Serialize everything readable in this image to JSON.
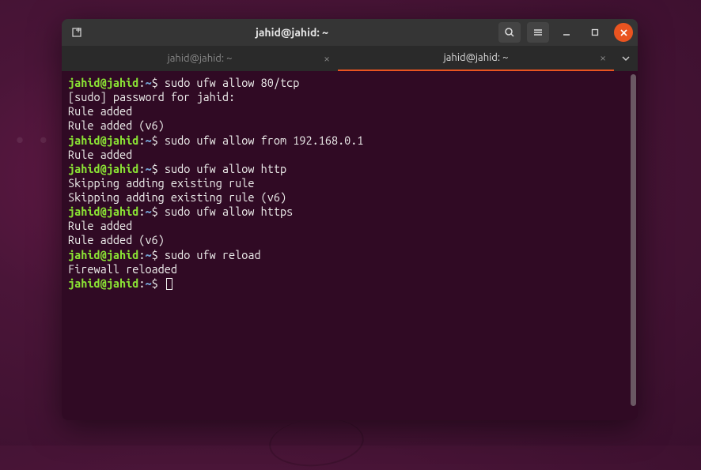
{
  "colors": {
    "accent": "#e95420",
    "terminal_bg": "#300a24",
    "prompt_user": "#8ae234",
    "prompt_path": "#729fcf",
    "text": "#eeeeec"
  },
  "titlebar": {
    "title": "jahid@jahid: ~"
  },
  "tabs": [
    {
      "label": "jahid@jahid: ~",
      "active": false
    },
    {
      "label": "jahid@jahid: ~",
      "active": true
    }
  ],
  "prompt": {
    "userhost": "jahid@jahid",
    "sep": ":",
    "path": "~",
    "symbol": "$"
  },
  "lines": [
    {
      "type": "cmd",
      "text": "sudo ufw allow 80/tcp"
    },
    {
      "type": "out",
      "text": "[sudo] password for jahid:"
    },
    {
      "type": "out",
      "text": "Rule added"
    },
    {
      "type": "out",
      "text": "Rule added (v6)"
    },
    {
      "type": "cmd",
      "text": "sudo ufw allow from 192.168.0.1"
    },
    {
      "type": "out",
      "text": "Rule added"
    },
    {
      "type": "cmd",
      "text": "sudo ufw allow http"
    },
    {
      "type": "out",
      "text": "Skipping adding existing rule"
    },
    {
      "type": "out",
      "text": "Skipping adding existing rule (v6)"
    },
    {
      "type": "cmd",
      "text": "sudo ufw allow https"
    },
    {
      "type": "out",
      "text": "Rule added"
    },
    {
      "type": "out",
      "text": "Rule added (v6)"
    },
    {
      "type": "cmd",
      "text": "sudo ufw reload"
    },
    {
      "type": "out",
      "text": "Firewall reloaded"
    },
    {
      "type": "cmd",
      "text": "",
      "cursor": true
    }
  ]
}
